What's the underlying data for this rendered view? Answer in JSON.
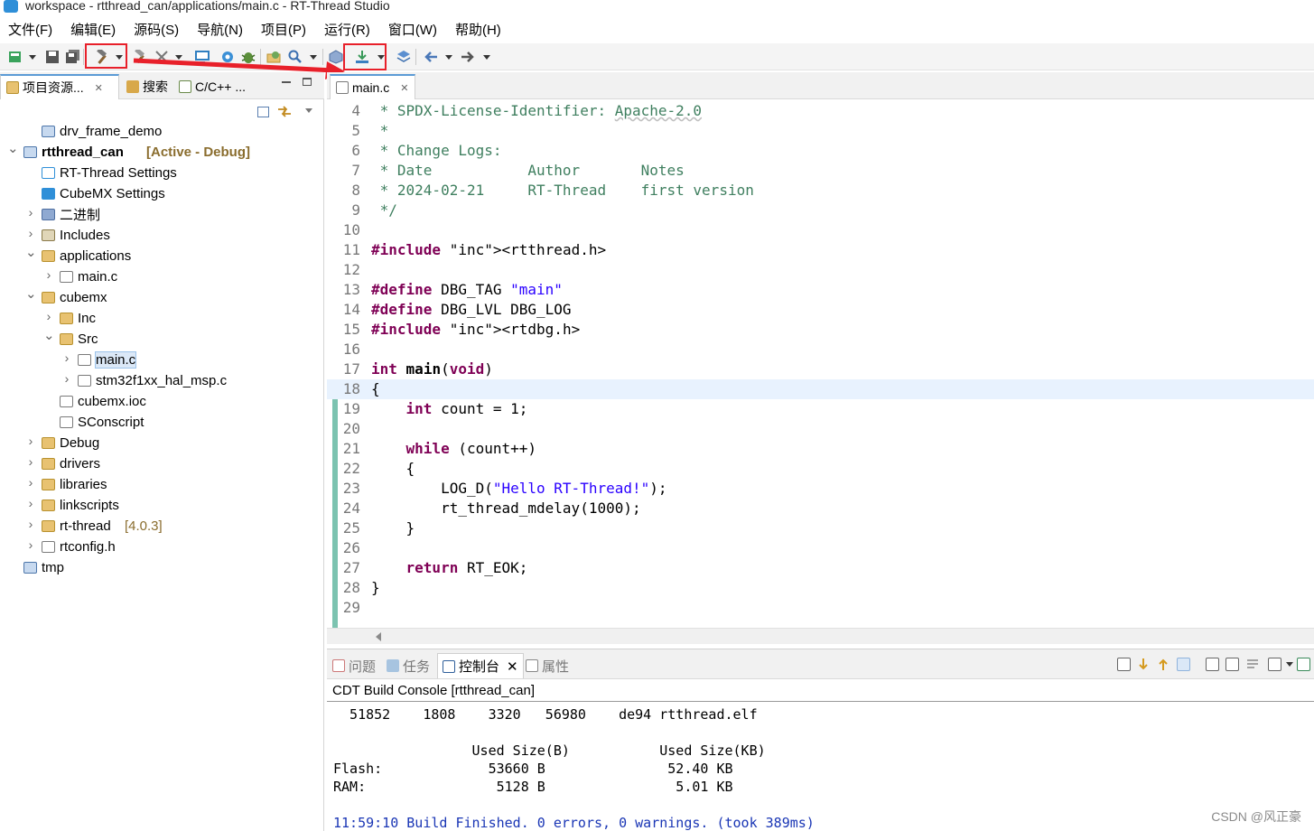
{
  "window": {
    "title": "workspace - rtthread_can/applications/main.c - RT-Thread Studio"
  },
  "menubar": [
    "文件(F)",
    "编辑(E)",
    "源码(S)",
    "导航(N)",
    "项目(P)",
    "运行(R)",
    "窗口(W)",
    "帮助(H)"
  ],
  "toolbar": {
    "icons": [
      "new-icon",
      "save-icon",
      "save-all-icon",
      "build-hammer-icon",
      "clean-icon",
      "tools-icon",
      "monitor-icon",
      "gear-icon",
      "debug-bug-icon",
      "open-folder-icon",
      "search-icon",
      "package-icon",
      "download-icon",
      "layers-icon",
      "back-arrow-icon",
      "forward-arrow-icon"
    ],
    "highlight_color": "#e8202a"
  },
  "left_panel": {
    "tabs": [
      {
        "label": "项目资源...",
        "icon": "project-explorer-icon"
      },
      {
        "label": "搜索",
        "icon": "search-icon"
      },
      {
        "label": "C/C++ ...",
        "icon": "cpp-icon"
      }
    ],
    "tree": [
      {
        "label": "drv_frame_demo",
        "icon": "project-icon",
        "arrow": ""
      },
      {
        "label": "rtthread_can",
        "tag": "[Active - Debug]",
        "icon": "project-icon",
        "arrow": "v"
      },
      {
        "label": "RT-Thread Settings",
        "icon": "rt-settings-icon",
        "arrow": ""
      },
      {
        "label": "CubeMX Settings",
        "icon": "cubemx-icon",
        "arrow": ""
      },
      {
        "label": "二进制",
        "icon": "binaries-icon",
        "arrow": ">"
      },
      {
        "label": "Includes",
        "icon": "includes-icon",
        "arrow": ">"
      },
      {
        "label": "applications",
        "icon": "folder-icon",
        "arrow": "v"
      },
      {
        "label": "main.c",
        "icon": "c-file-icon",
        "arrow": ">"
      },
      {
        "label": "cubemx",
        "icon": "folder-icon",
        "arrow": "v"
      },
      {
        "label": "Inc",
        "icon": "folder-icon",
        "arrow": ">"
      },
      {
        "label": "Src",
        "icon": "folder-icon",
        "arrow": "v"
      },
      {
        "label": "main.c",
        "icon": "c-file-icon",
        "arrow": ">"
      },
      {
        "label": "stm32f1xx_hal_msp.c",
        "icon": "c-file-icon",
        "arrow": ">"
      },
      {
        "label": "cubemx.ioc",
        "icon": "file-icon",
        "arrow": ""
      },
      {
        "label": "SConscript",
        "icon": "file-icon",
        "arrow": ""
      },
      {
        "label": "Debug",
        "icon": "folder-icon",
        "arrow": ">"
      },
      {
        "label": "drivers",
        "icon": "folder-icon",
        "arrow": ">"
      },
      {
        "label": "libraries",
        "icon": "folder-icon",
        "arrow": ">"
      },
      {
        "label": "linkscripts",
        "icon": "folder-icon",
        "arrow": ">"
      },
      {
        "label": "rt-thread",
        "tag": "[4.0.3]",
        "icon": "folder-icon",
        "arrow": ">"
      },
      {
        "label": "rtconfig.h",
        "icon": "h-file-icon",
        "arrow": ">"
      },
      {
        "label": "tmp",
        "icon": "project-icon",
        "arrow": ""
      }
    ]
  },
  "editor": {
    "tab": {
      "label": "main.c",
      "icon": "c-file-icon"
    },
    "lines": [
      {
        "n": "4",
        "t": " * SPDX-License-Identifier: Apache-2.0"
      },
      {
        "n": "5",
        "t": " *"
      },
      {
        "n": "6",
        "t": " * Change Logs:"
      },
      {
        "n": "7",
        "t": " * Date           Author       Notes"
      },
      {
        "n": "8",
        "t": " * 2024-02-21     RT-Thread    first version"
      },
      {
        "n": "9",
        "t": " */"
      },
      {
        "n": "10",
        "t": ""
      },
      {
        "n": "11",
        "t": "#include <rtthread.h>"
      },
      {
        "n": "12",
        "t": ""
      },
      {
        "n": "13",
        "t": "#define DBG_TAG \"main\""
      },
      {
        "n": "14",
        "t": "#define DBG_LVL DBG_LOG"
      },
      {
        "n": "15",
        "t": "#include <rtdbg.h>"
      },
      {
        "n": "16",
        "t": ""
      },
      {
        "n": "17",
        "t": "int main(void)"
      },
      {
        "n": "18",
        "t": "{"
      },
      {
        "n": "19",
        "t": "    int count = 1;"
      },
      {
        "n": "20",
        "t": ""
      },
      {
        "n": "21",
        "t": "    while (count++)"
      },
      {
        "n": "22",
        "t": "    {"
      },
      {
        "n": "23",
        "t": "        LOG_D(\"Hello RT-Thread!\");"
      },
      {
        "n": "24",
        "t": "        rt_thread_mdelay(1000);"
      },
      {
        "n": "25",
        "t": "    }"
      },
      {
        "n": "26",
        "t": ""
      },
      {
        "n": "27",
        "t": "    return RT_EOK;"
      },
      {
        "n": "28",
        "t": "}"
      },
      {
        "n": "29",
        "t": ""
      }
    ]
  },
  "console": {
    "tabs": [
      {
        "label": "问题",
        "icon": "problems-icon"
      },
      {
        "label": "任务",
        "icon": "tasks-icon"
      },
      {
        "label": "控制台",
        "icon": "console-icon"
      },
      {
        "label": "属性",
        "icon": "properties-icon"
      }
    ],
    "header": "CDT Build Console [rtthread_can]",
    "lines": [
      "  51852    1808    3320   56980    de94 rtthread.elf",
      "",
      "                 Used Size(B)           Used Size(KB)",
      "Flash:             53660 B               52.40 KB",
      "RAM:                5128 B                5.01 KB",
      "",
      "11:59:10 Build Finished. 0 errors, 0 warnings. (took 389ms)"
    ]
  },
  "watermark": "CSDN @风正豪"
}
